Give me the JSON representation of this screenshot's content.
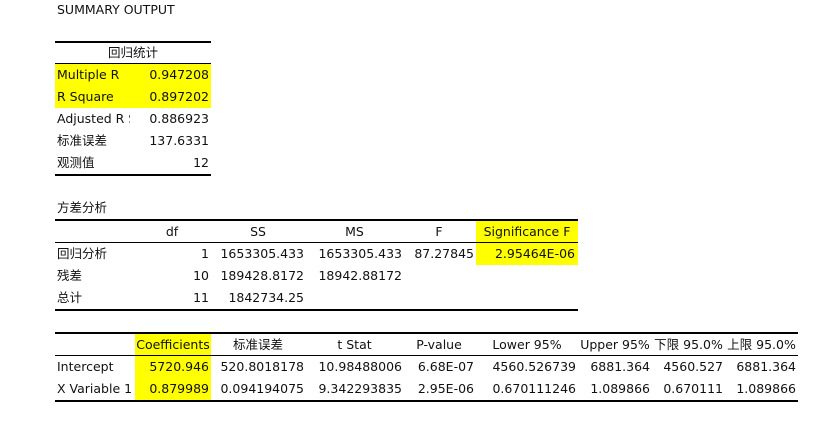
{
  "title": "SUMMARY OUTPUT",
  "regression_stats": {
    "header": "回归统计",
    "rows": [
      {
        "label": "Multiple R",
        "value": "0.947208"
      },
      {
        "label": "R Square",
        "value": "0.897202"
      },
      {
        "label": "Adjusted R Square",
        "value": "0.886923"
      },
      {
        "label": "标准误差",
        "value": "137.6331"
      },
      {
        "label": "观测值",
        "value": "12"
      }
    ]
  },
  "anova": {
    "title": "方差分析",
    "headers": [
      "df",
      "SS",
      "MS",
      "F",
      "Significance F"
    ],
    "rows": [
      {
        "label": "回归分析",
        "df": "1",
        "ss": "1653305.433",
        "ms": "1653305.433",
        "f": "87.27845",
        "sig": "2.95464E-06"
      },
      {
        "label": "残差",
        "df": "10",
        "ss": "189428.8172",
        "ms": "18942.88172",
        "f": "",
        "sig": ""
      },
      {
        "label": "总计",
        "df": "11",
        "ss": "1842734.25",
        "ms": "",
        "f": "",
        "sig": ""
      }
    ]
  },
  "coefficients": {
    "headers": [
      "Coefficients",
      "标准误差",
      "t Stat",
      "P-value",
      "Lower 95%",
      "Upper 95%",
      "下限 95.0%",
      "上限 95.0%"
    ],
    "rows": [
      {
        "label": "Intercept",
        "values": [
          "5720.946",
          "520.8018178",
          "10.98488006",
          "6.68E-07",
          "4560.526739",
          "6881.364",
          "4560.527",
          "6881.364"
        ]
      },
      {
        "label": "X Variable 1",
        "values": [
          "0.879989",
          "0.094194075",
          "9.342293835",
          "2.95E-06",
          "0.670111246",
          "1.089866",
          "0.670111",
          "1.089866"
        ]
      }
    ]
  },
  "highlight_color": "#ffff00"
}
